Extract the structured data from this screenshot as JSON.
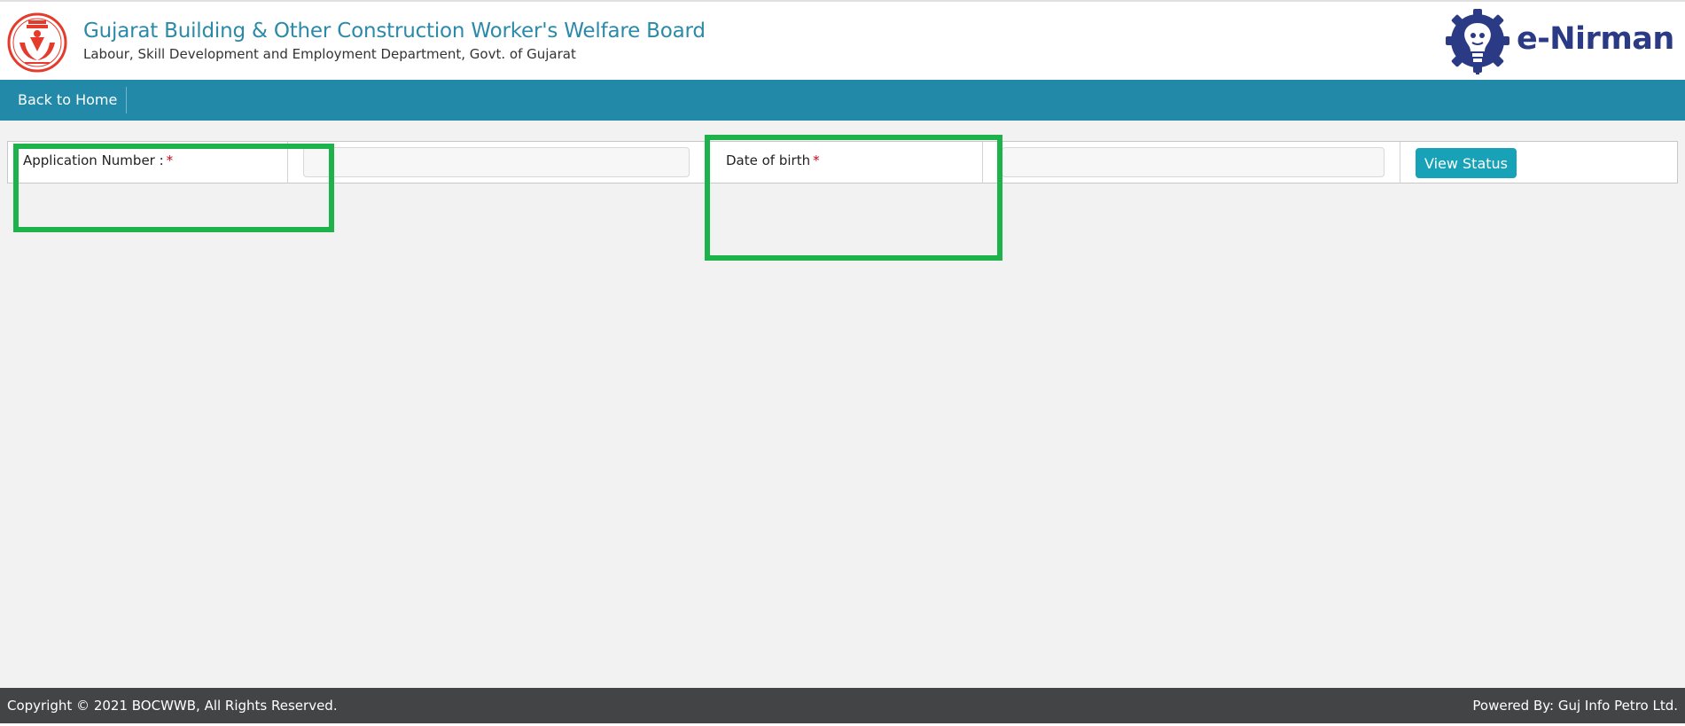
{
  "header": {
    "title": "Gujarat Building & Other Construction Worker's Welfare Board",
    "subtitle": "Labour, Skill Development and Employment Department, Govt. of Gujarat",
    "brand_name": "e-Nirman",
    "board_logo_icon": "board-emblem-icon",
    "brand_icon": "gear-bulb-icon"
  },
  "nav": {
    "items": [
      {
        "label": "Back to Home"
      }
    ]
  },
  "form": {
    "application_number": {
      "label": "Application Number :",
      "required_mark": "*",
      "value": "",
      "placeholder": ""
    },
    "date_of_birth": {
      "label": "Date of birth",
      "required_mark": "*",
      "value": "",
      "placeholder": ""
    },
    "submit_label": "View Status"
  },
  "footer": {
    "copyright": "Copyright © 2021 BOCWWB, All Rights Reserved.",
    "powered_by": "Powered By: Guj Info Petro Ltd."
  },
  "colors": {
    "nav_bg": "#2289a9",
    "title": "#2b8aa8",
    "brand": "#2b3a85",
    "button": "#17a2b8",
    "highlight": "#1db34a",
    "footer_bg": "#424446",
    "required": "#d0021b",
    "logo_red": "#e53b2c"
  }
}
